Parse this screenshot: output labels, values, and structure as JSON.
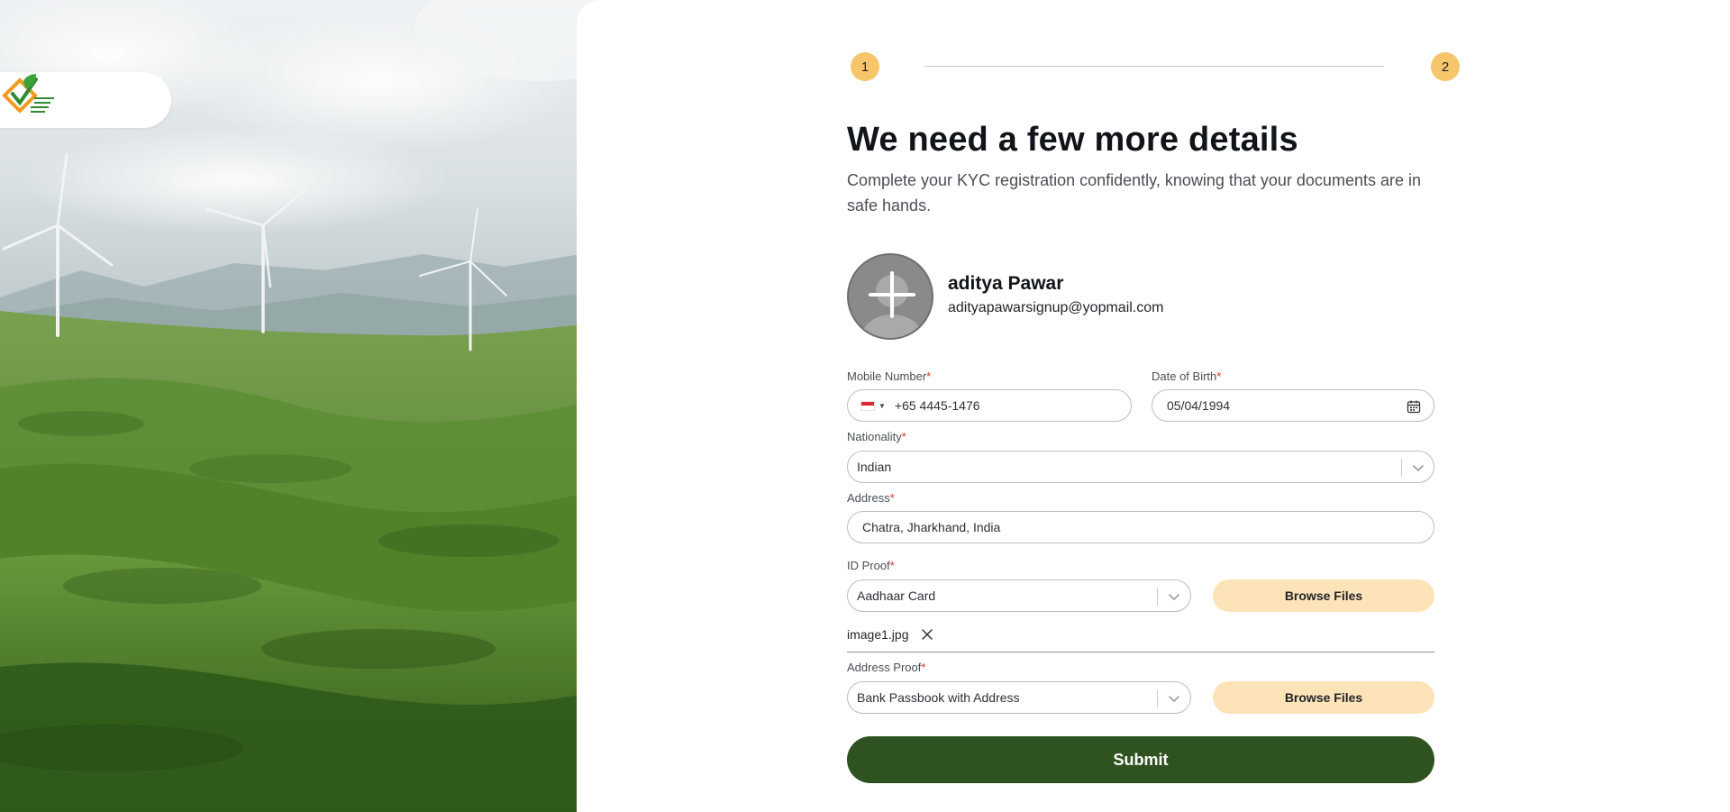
{
  "stepper": {
    "step1": "1",
    "step2": "2"
  },
  "heading": {
    "title": "We need a few more details",
    "subtitle": "Complete your KYC registration confidently, knowing that your documents are in safe hands."
  },
  "profile": {
    "name": "aditya Pawar",
    "email": "adityapawarsignup@yopmail.com"
  },
  "form": {
    "mobile": {
      "label": "Mobile Number",
      "required": "*",
      "country_code": "SG",
      "value": "+65 4445-1476"
    },
    "dob": {
      "label": "Date of Birth",
      "required": "*",
      "value": "05/04/1994"
    },
    "nationality": {
      "label": "Nationality",
      "required": "*",
      "value": "Indian"
    },
    "address": {
      "label": "Address",
      "required": "*",
      "value": "Chatra, Jharkhand, India"
    },
    "id_proof": {
      "label": "ID Proof",
      "required": "*",
      "value": "Aadhaar Card",
      "browse_label": "Browse Files",
      "uploaded_file": "image1.jpg"
    },
    "address_proof": {
      "label": "Address Proof",
      "required": "*",
      "value": "Bank Passbook with Address",
      "browse_label": "Browse Files"
    },
    "submit_label": "Submit"
  },
  "colors": {
    "accent_step": "#f7c66b",
    "browse_bg": "#fde3b8",
    "submit_bg": "#2f5320",
    "required": "#d9342b"
  },
  "icons": [
    "logo-icon",
    "add-photo-icon",
    "flag-sg-icon",
    "calendar-icon",
    "chevron-down-icon",
    "close-icon"
  ]
}
